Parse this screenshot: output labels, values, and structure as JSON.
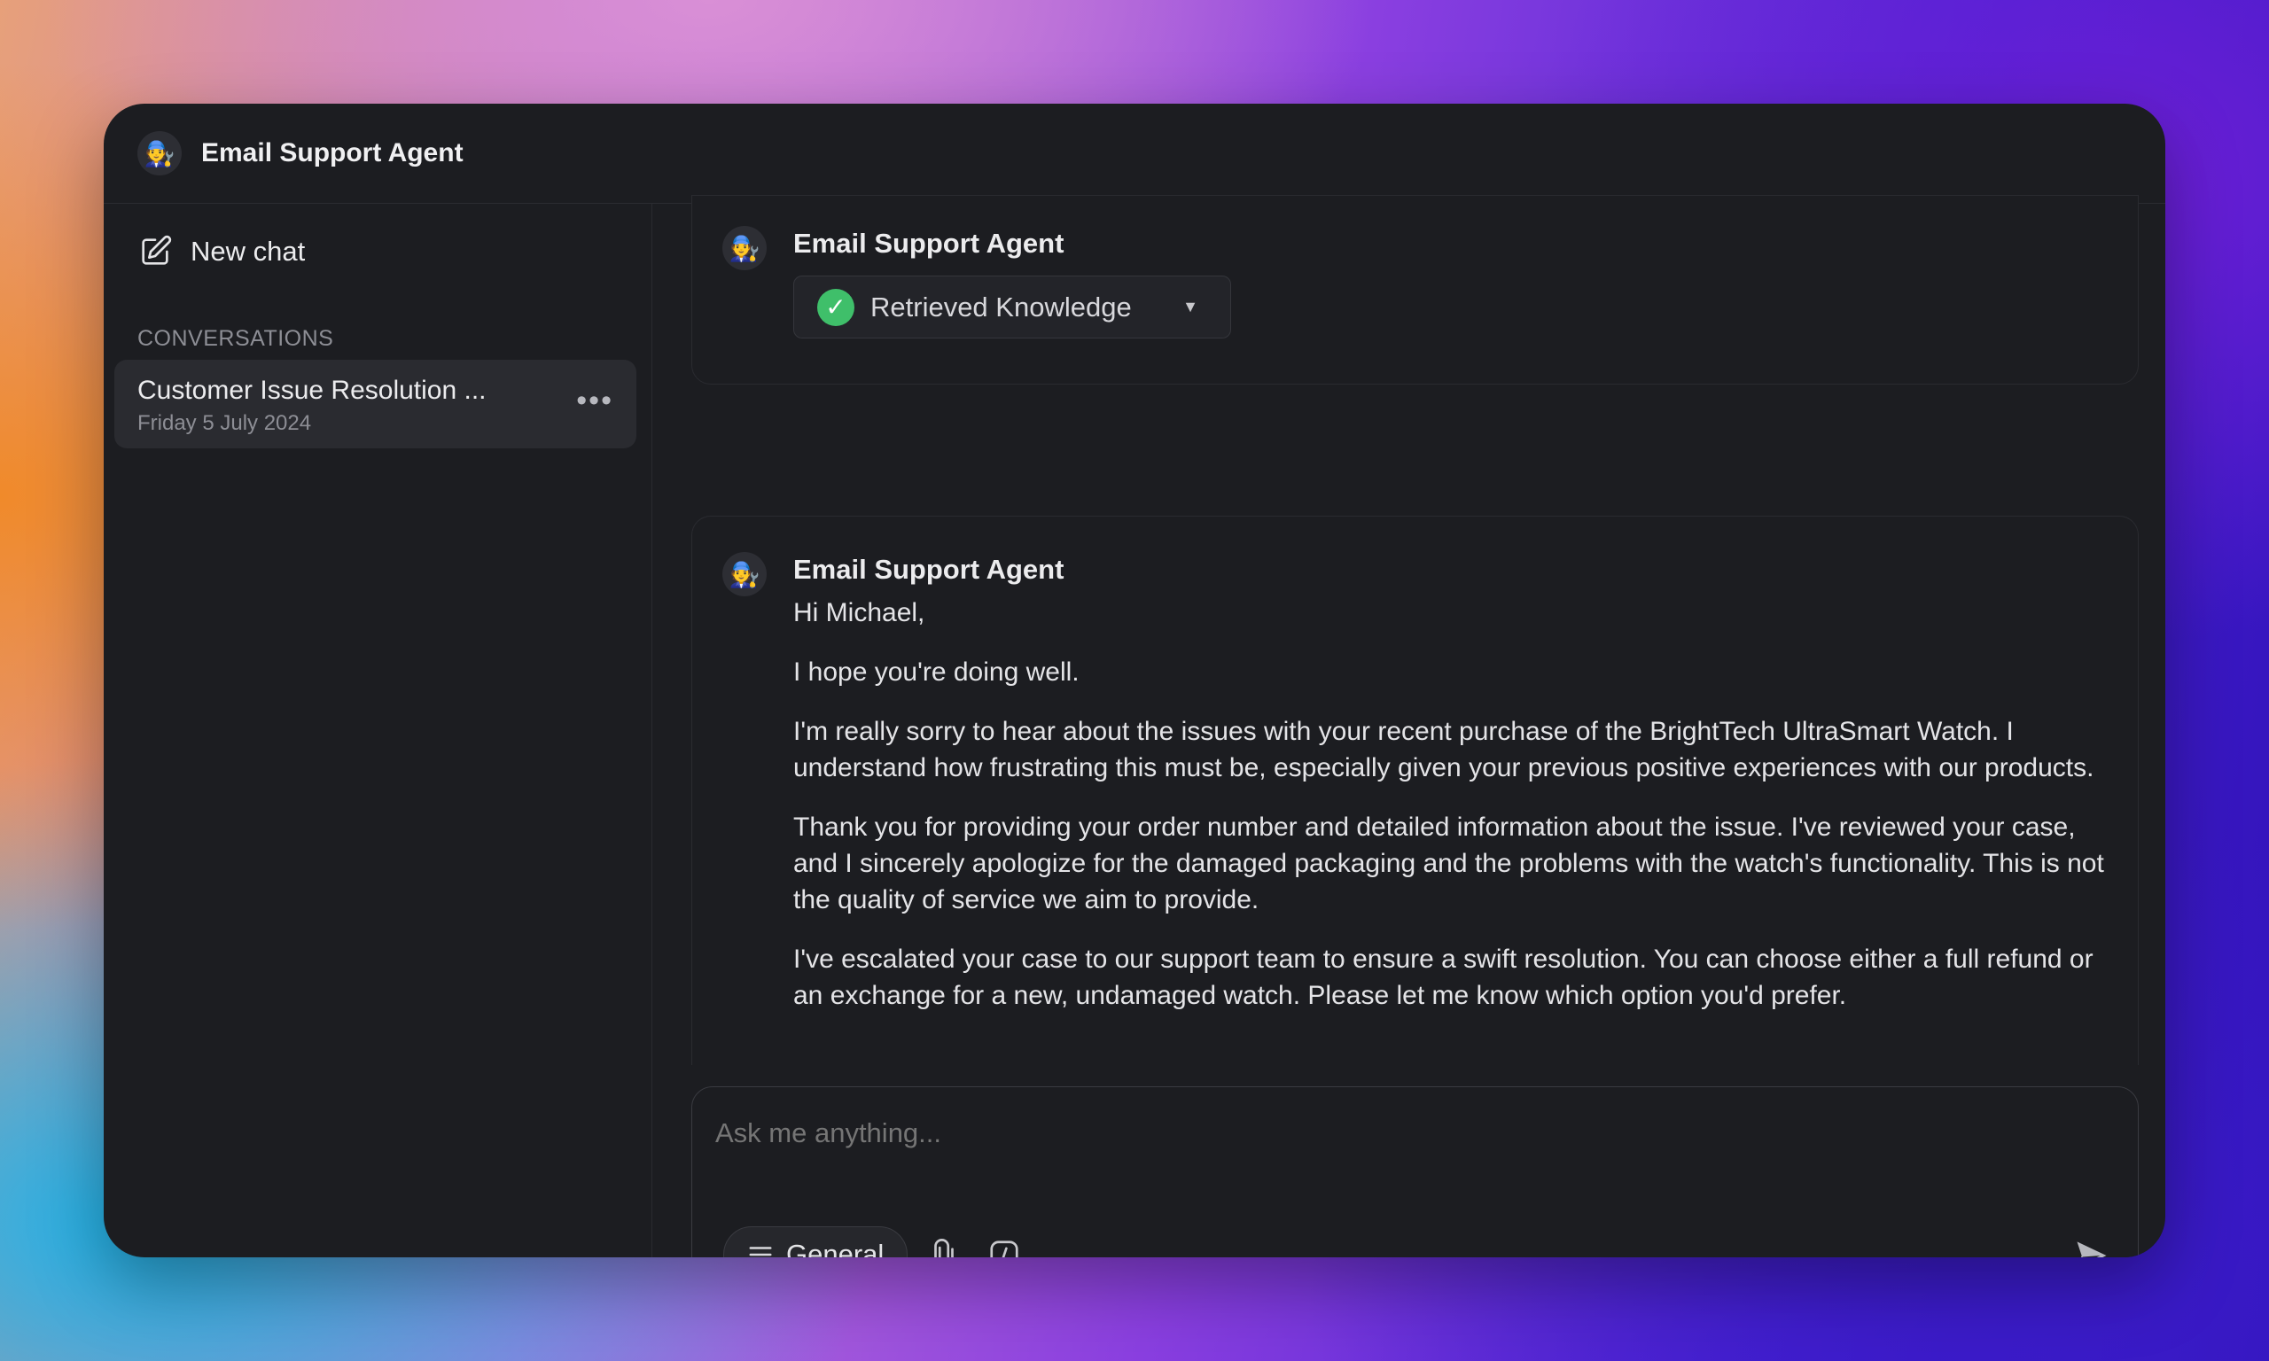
{
  "window": {
    "title": "Email Support Agent",
    "avatar_emoji": "🧑‍🔧"
  },
  "sidebar": {
    "new_chat_label": "New chat",
    "conversations_heading": "CONVERSATIONS",
    "conversations": [
      {
        "title": "Customer Issue Resolution ...",
        "date": "Friday 5 July 2024"
      }
    ]
  },
  "messages": [
    {
      "author": "Email Support Agent",
      "tool_label": "Retrieved Knowledge",
      "tool_status": "success"
    },
    {
      "author": "Email Support Agent",
      "paragraphs": [
        "Hi Michael,",
        "I hope you're doing well.",
        "I'm really sorry to hear about the issues with your recent purchase of the BrightTech UltraSmart Watch. I understand how frustrating this must be, especially given your previous positive experiences with our products.",
        "Thank you for providing your order number and detailed information about the issue. I've reviewed your case, and I sincerely apologize for the damaged packaging and the problems with the watch's functionality. This is not the quality of service we aim to provide.",
        "I've escalated your case to our support team to ensure a swift resolution. You can choose either a full refund or an exchange for a new, undamaged watch. Please let me know which option you'd prefer."
      ]
    }
  ],
  "composer": {
    "placeholder": "Ask me anything...",
    "mode_label": "General"
  },
  "colors": {
    "window_bg": "#1c1d21",
    "success_green": "#3fbf6a",
    "muted_text": "#8d8e95"
  }
}
